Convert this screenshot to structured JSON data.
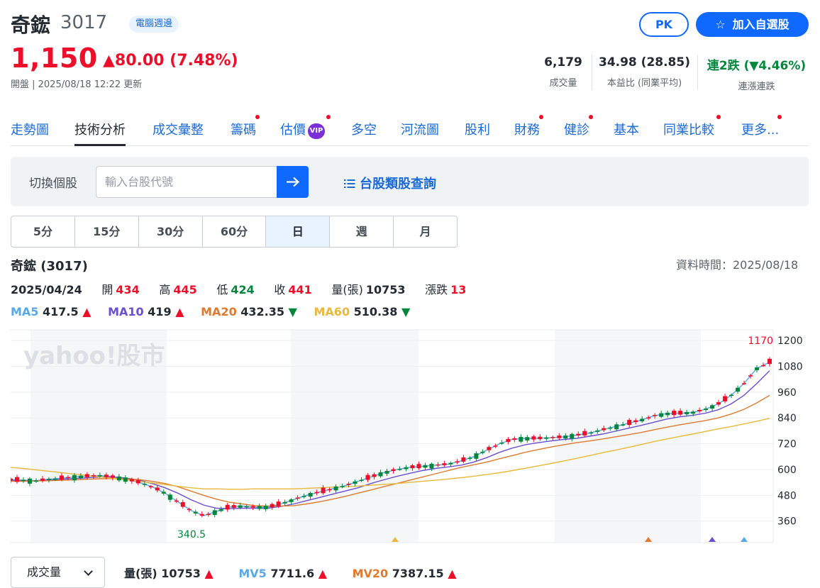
{
  "header": {
    "name": "奇鋐",
    "code": "3017",
    "sector": "電腦週邊",
    "pk_label": "PK",
    "watch_label": "加入自選股",
    "price": "1,150",
    "change": "▲80.00 (7.48%)",
    "status": "開盤 | 2025/08/18 12:22 更新"
  },
  "stats": [
    {
      "value": "6,179",
      "label": "成交量"
    },
    {
      "value": "34.98 (28.85)",
      "label": "本益比 (同業平均)"
    },
    {
      "value": "連2跌 (▼4.46%)",
      "label": "連漲連跌"
    }
  ],
  "tabs": [
    "走勢圖",
    "技術分析",
    "成交彙整",
    "籌碼",
    "估價",
    "多空",
    "河流圖",
    "股利",
    "財務",
    "健診",
    "基本",
    "同業比較",
    "更多..."
  ],
  "vip_label": "VIP",
  "search": {
    "label": "切換個股",
    "placeholder": "輸入台股代號",
    "category_link": "台股類股查詢"
  },
  "periods": [
    "5分",
    "15分",
    "30分",
    "60分",
    "日",
    "週",
    "月"
  ],
  "active_period": "日",
  "chart_info": {
    "title": "奇鋐 (3017)",
    "data_time": "資料時間：2025/08/18",
    "date": "2025/04/24",
    "open_label": "開",
    "open": "434",
    "high_label": "高",
    "high": "445",
    "low_label": "低",
    "low": "424",
    "close_label": "收",
    "close": "441",
    "vol_label": "量(張)",
    "vol": "10753",
    "chg_label": "漲跌",
    "chg": "13"
  },
  "ma": [
    {
      "label": "MA5",
      "value": "417.5",
      "dir": "▲",
      "color": "#5aa9e6"
    },
    {
      "label": "MA10",
      "value": "419",
      "dir": "▲",
      "color": "#6a4fd3"
    },
    {
      "label": "MA20",
      "value": "432.35",
      "dir": "▼",
      "color": "#e07a2f"
    },
    {
      "label": "MA60",
      "value": "510.38",
      "dir": "▼",
      "color": "#e8b93c"
    }
  ],
  "chart_data": {
    "type": "line",
    "y_ticks": [
      "1200",
      "1080",
      "960",
      "840",
      "720",
      "600",
      "480",
      "360"
    ],
    "ylim": [
      260,
      1250
    ],
    "max_label": "1170",
    "min_label": "340.5",
    "watermark": "yahoo!股市",
    "series": [
      {
        "name": "MA5",
        "color": "#5aa9e6",
        "values": [
          552,
          550,
          548,
          555,
          560,
          565,
          570,
          572,
          565,
          555,
          540,
          520,
          490,
          450,
          410,
          385,
          405,
          425,
          430,
          425,
          425,
          440,
          460,
          480,
          495,
          510,
          525,
          545,
          565,
          585,
          600,
          610,
          615,
          620,
          625,
          640,
          660,
          690,
          720,
          740,
          745,
          745,
          748,
          752,
          760,
          770,
          785,
          800,
          815,
          830,
          850,
          860,
          862,
          865,
          880,
          905,
          945,
          1000,
          1070,
          1100
        ]
      },
      {
        "name": "MA10",
        "color": "#6a4fd3",
        "values": [
          550,
          548,
          548,
          550,
          555,
          558,
          562,
          565,
          565,
          560,
          550,
          535,
          515,
          490,
          460,
          435,
          420,
          418,
          420,
          420,
          420,
          428,
          440,
          455,
          470,
          485,
          500,
          515,
          535,
          552,
          568,
          582,
          595,
          605,
          612,
          620,
          635,
          655,
          680,
          700,
          715,
          725,
          733,
          740,
          745,
          755,
          765,
          778,
          792,
          805,
          820,
          835,
          845,
          852,
          862,
          878,
          905,
          945,
          1000,
          1060
        ]
      },
      {
        "name": "MA20",
        "color": "#e07a2f",
        "values": [
          545,
          545,
          547,
          548,
          550,
          552,
          555,
          557,
          558,
          557,
          553,
          545,
          535,
          520,
          500,
          480,
          462,
          448,
          440,
          432,
          430,
          430,
          432,
          440,
          450,
          462,
          475,
          490,
          505,
          520,
          535,
          550,
          565,
          580,
          595,
          610,
          622,
          635,
          650,
          665,
          680,
          693,
          705,
          715,
          725,
          733,
          742,
          752,
          762,
          772,
          785,
          797,
          808,
          818,
          828,
          840,
          858,
          880,
          910,
          945
        ]
      },
      {
        "name": "MA60",
        "color": "#e8b93c",
        "values": [
          610,
          605,
          598,
          592,
          585,
          578,
          572,
          565,
          558,
          552,
          545,
          538,
          530,
          522,
          515,
          510,
          510,
          508,
          508,
          510,
          510,
          510,
          510,
          512,
          515,
          518,
          520,
          523,
          527,
          531,
          535,
          540,
          545,
          550,
          556,
          562,
          569,
          577,
          585,
          595,
          606,
          617,
          628,
          640,
          652,
          665,
          678,
          690,
          703,
          716,
          730,
          742,
          754,
          765,
          777,
          789,
          800,
          812,
          825,
          838
        ]
      }
    ]
  },
  "volume": {
    "select_label": "成交量",
    "vol_label": "量(張)",
    "vol_value": "10753",
    "vol_dir": "▲",
    "mv5_label": "MV5",
    "mv5_value": "7711.6",
    "mv5_dir": "▲",
    "mv20_label": "MV20",
    "mv20_value": "7387.15",
    "mv20_dir": "▲"
  },
  "colors": {
    "up": "#eb0f29",
    "down": "#00873c",
    "accent": "#0f69ff"
  }
}
